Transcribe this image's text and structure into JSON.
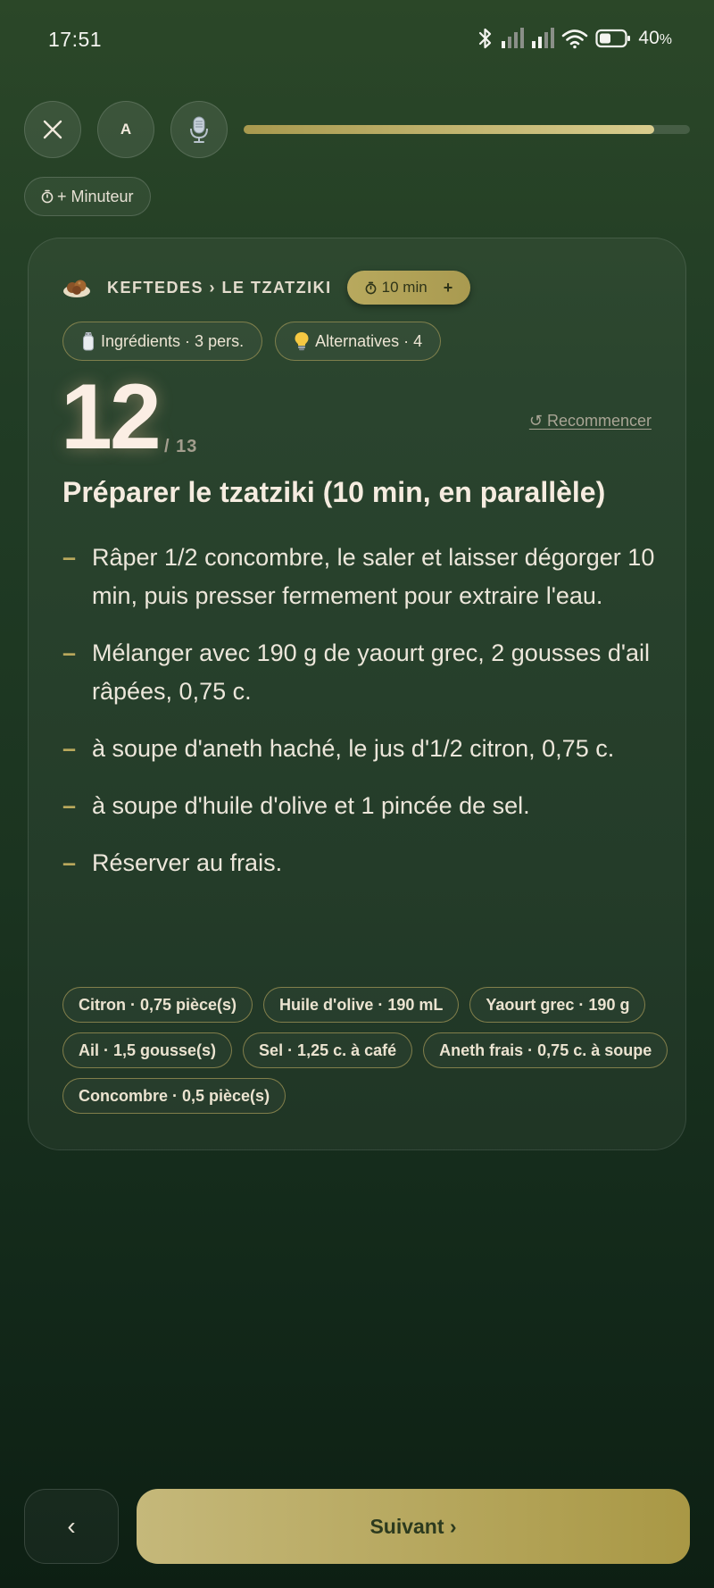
{
  "status_bar": {
    "time": "17:51",
    "battery": "40",
    "battery_unit": "%"
  },
  "controls": {
    "font_button_label": "A",
    "progress_percent": 92,
    "timer_label": "+ Minuteur"
  },
  "card": {
    "breadcrumb": "KEFTEDES › LE TZATZIKI",
    "duration_label": "10 min",
    "duration_plus": "+",
    "chips": {
      "ingredients": "Ingrédients · 3 pers.",
      "alternatives": "Alternatives · 4"
    },
    "step_number": "12",
    "step_total": "/ 13",
    "restart_label": "Recommencer",
    "step_title": "Préparer le tzatziki (10 min, en parallèle)",
    "instructions": [
      "Râper 1/2 concombre, le saler et laisser dégorger 10 min, puis presser fermement pour extraire l'eau.",
      "Mélanger avec 190 g de yaourt grec, 2 gousses d'ail râpées, 0,75 c.",
      "à soupe d'aneth haché, le jus d'1/2 citron, 0,75 c.",
      "à soupe d'huile d'olive et 1 pincée de sel.",
      "Réserver au frais."
    ],
    "tags": [
      "Citron · 0,75 pièce(s)",
      "Huile d'olive · 190 mL",
      "Yaourt grec · 190 g",
      "Ail · 1,5 gousse(s)",
      "Sel · 1,25 c. à café",
      "Aneth frais · 0,75 c. à soupe",
      "Concombre · 0,5 pièce(s)"
    ]
  },
  "nav": {
    "back_label": "‹",
    "next_label": "Suivant ›"
  },
  "colors": {
    "accent_gold": "#b8a95e",
    "background_green": "#1b3420"
  }
}
